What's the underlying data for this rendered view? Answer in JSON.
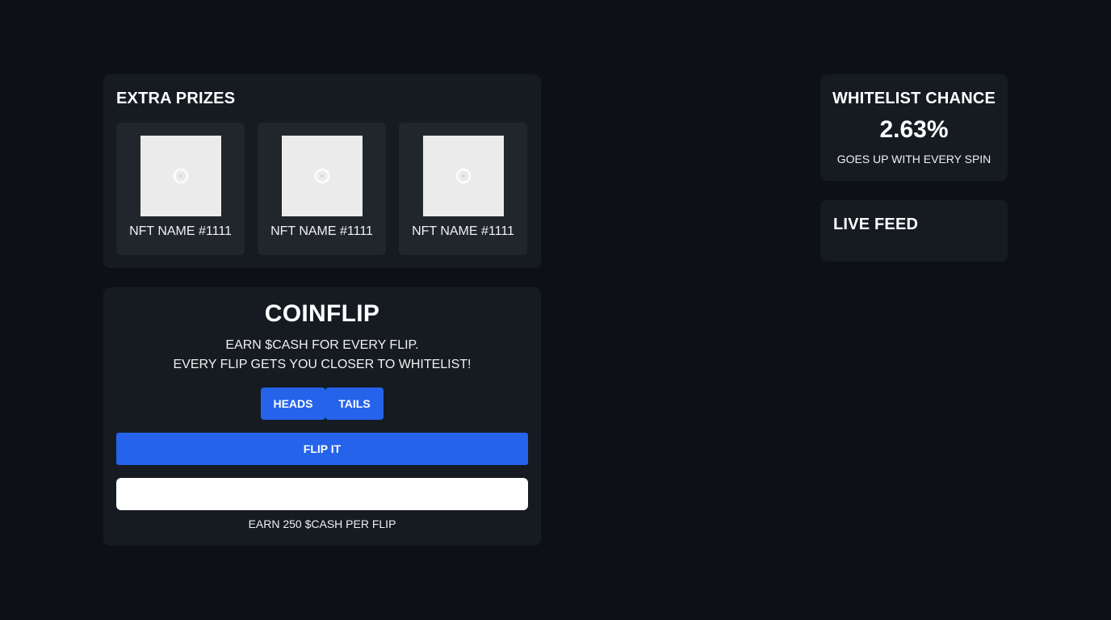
{
  "extra_prizes": {
    "title": "EXTRA PRIZES",
    "items": [
      {
        "name": "NFT NAME #1111",
        "icon": "loading-spinner-icon"
      },
      {
        "name": "NFT NAME #1111",
        "icon": "loading-spinner-icon"
      },
      {
        "name": "NFT NAME #1111",
        "icon": "loading-spinner-icon"
      }
    ]
  },
  "coinflip": {
    "title": "COINFLIP",
    "line1": "EARN $CASH FOR EVERY FLIP.",
    "line2": "EVERY FLIP GETS YOU CLOSER TO WHITELIST!",
    "heads_label": "HEADS",
    "tails_label": "TAILS",
    "flip_label": "FLIP IT",
    "input_value": "",
    "earn_note": "EARN 250 $CASH PER FLIP"
  },
  "whitelist": {
    "title": "WHITELIST CHANCE",
    "chance": "2.63%",
    "note": "GOES UP WITH EVERY SPIN"
  },
  "live_feed": {
    "title": "LIVE FEED"
  },
  "colors": {
    "background": "#0d1117",
    "panel": "#161b22",
    "card": "#21262d",
    "accent": "#2563eb"
  }
}
